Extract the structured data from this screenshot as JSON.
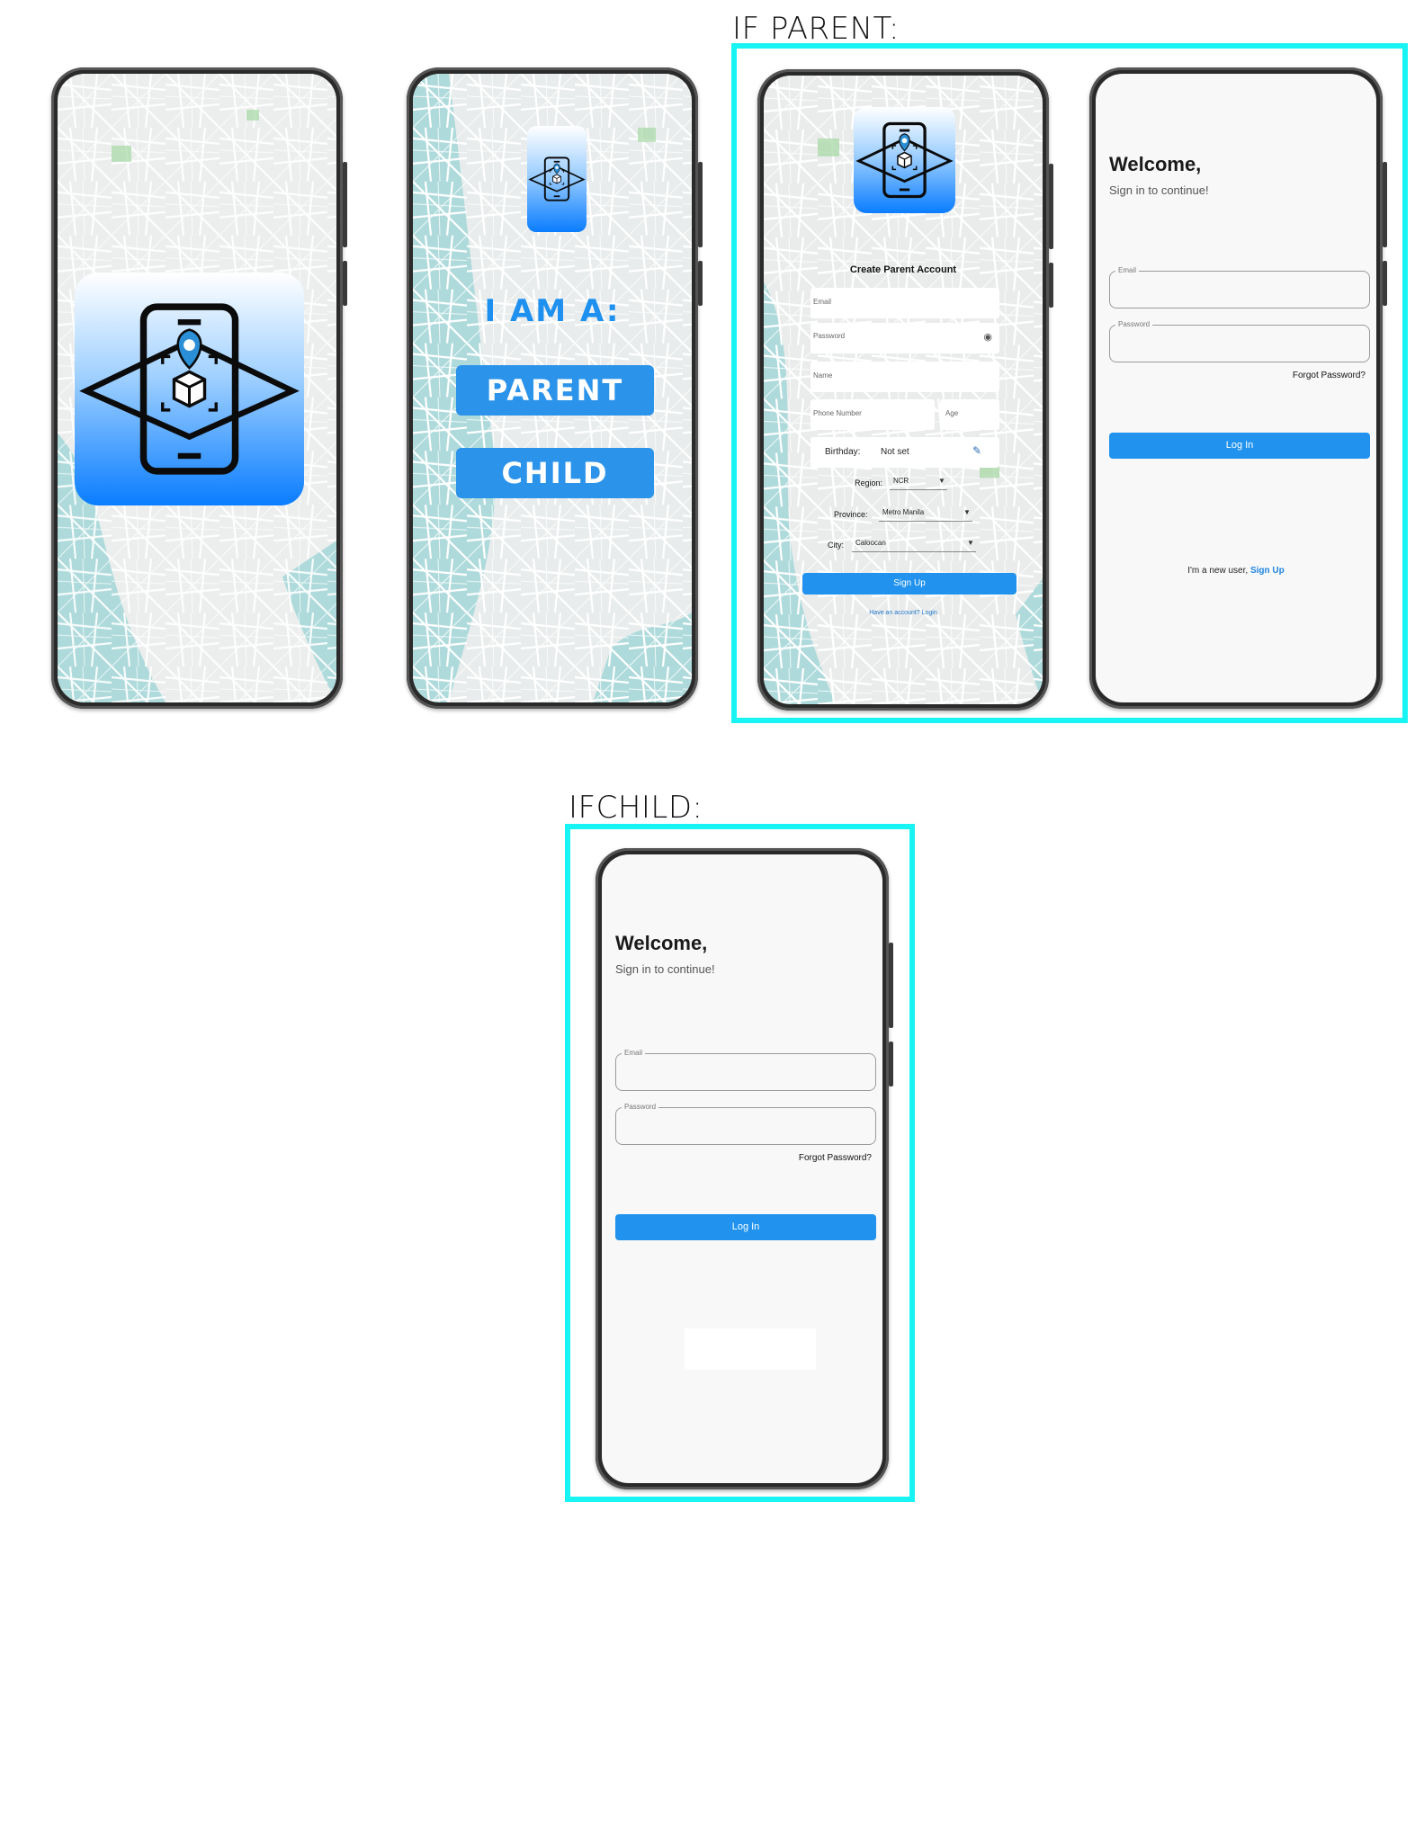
{
  "labels": {
    "if_parent": "IF PARENT:",
    "if_child": "IFCHILD:"
  },
  "role_screen": {
    "heading": "I AM A:",
    "parent_button": "PARENT",
    "child_button": "CHILD"
  },
  "signup": {
    "title": "Create Parent Account",
    "email_placeholder": "Email",
    "password_placeholder": "Password",
    "name_placeholder": "Name",
    "phone_placeholder": "Phone Number",
    "age_placeholder": "Age",
    "birthday_label": "Birthday:",
    "birthday_value": "Not set",
    "region_label": "Region:",
    "region_value": "NCR",
    "province_label": "Province:",
    "province_value": "Metro Manila",
    "city_label": "City:",
    "city_value": "Caloocan",
    "signup_button": "Sign Up",
    "login_link": "Have an account? Login"
  },
  "login_parent": {
    "welcome": "Welcome,",
    "subtitle": "Sign in to continue!",
    "email_label": "Email",
    "password_label": "Password",
    "forgot": "Forgot Password?",
    "login_button": "Log In",
    "new_user_text": "I'm a new user,",
    "signup_link": "Sign Up"
  },
  "login_child": {
    "welcome": "Welcome,",
    "subtitle": "Sign in to continue!",
    "email_label": "Email",
    "password_label": "Password",
    "forgot": "Forgot Password?",
    "login_button": "Log In"
  },
  "colors": {
    "highlight": "#18f4f4",
    "primary": "#2193ee",
    "map_land": "#eeeeee",
    "map_water": "#aedadb",
    "map_park": "#a7d8a5"
  },
  "icons": [
    "phone-ar-logo-icon",
    "eye-icon",
    "pencil-icon",
    "dropdown-caret-icon"
  ]
}
